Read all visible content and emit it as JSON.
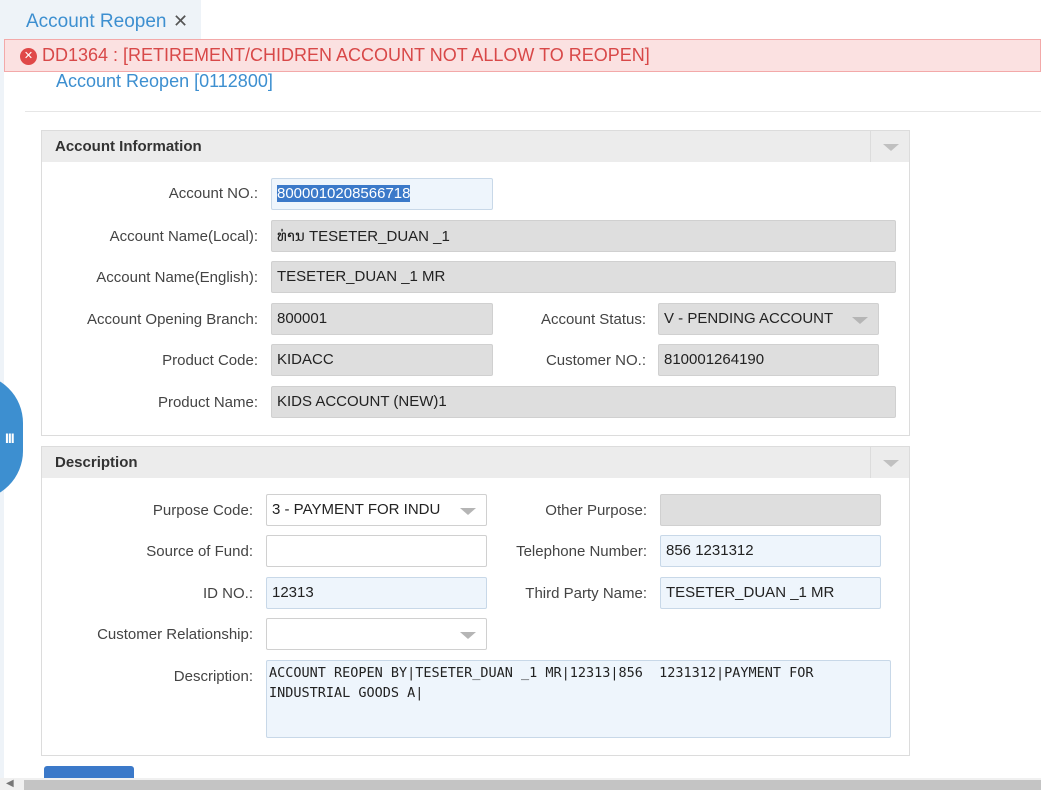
{
  "tab": {
    "label": "Account Reopen",
    "close": "✕"
  },
  "error": {
    "icon": "✕",
    "message": "DD1364 : [RETIREMENT/CHIDREN ACCOUNT NOT ALLOW TO REOPEN]"
  },
  "page": {
    "title": "Account Reopen [0112800]"
  },
  "account_info": {
    "title": "Account Information",
    "account_no": {
      "label": "Account NO.:",
      "value": "8000010208566718"
    },
    "account_name_local": {
      "label": "Account Name(Local):",
      "value": "ທ່ານ TESETER_DUAN _1"
    },
    "account_name_english": {
      "label": "Account Name(English):",
      "value": "TESETER_DUAN _1 MR"
    },
    "opening_branch": {
      "label": "Account Opening Branch:",
      "value": "800001"
    },
    "account_status": {
      "label": "Account Status:",
      "value": "V - PENDING ACCOUNT"
    },
    "product_code": {
      "label": "Product Code:",
      "value": "KIDACC"
    },
    "customer_no": {
      "label": "Customer NO.:",
      "value": "810001264190"
    },
    "product_name": {
      "label": "Product Name:",
      "value": "KIDS ACCOUNT (NEW)1"
    }
  },
  "description_section": {
    "title": "Description",
    "purpose_code": {
      "label": "Purpose Code:",
      "value": "3 - PAYMENT FOR INDU"
    },
    "other_purpose": {
      "label": "Other Purpose:",
      "value": ""
    },
    "source_of_fund": {
      "label": "Source of Fund:",
      "value": ""
    },
    "telephone_number": {
      "label": "Telephone Number:",
      "value": "856  1231312"
    },
    "id_no": {
      "label": "ID NO.:",
      "value": "12313"
    },
    "third_party_name": {
      "label": "Third Party Name:",
      "value": "TESETER_DUAN _1 MR"
    },
    "customer_relationship": {
      "label": "Customer Relationship:",
      "value": ""
    },
    "description": {
      "label": "Description:",
      "value": "ACCOUNT REOPEN BY|TESETER_DUAN _1 MR|12313|856  1231312|PAYMENT FOR INDUSTRIAL GOODS A|"
    }
  },
  "side_handle": {
    "icon": "III"
  },
  "scrollbar": {
    "arrow": "◀"
  }
}
